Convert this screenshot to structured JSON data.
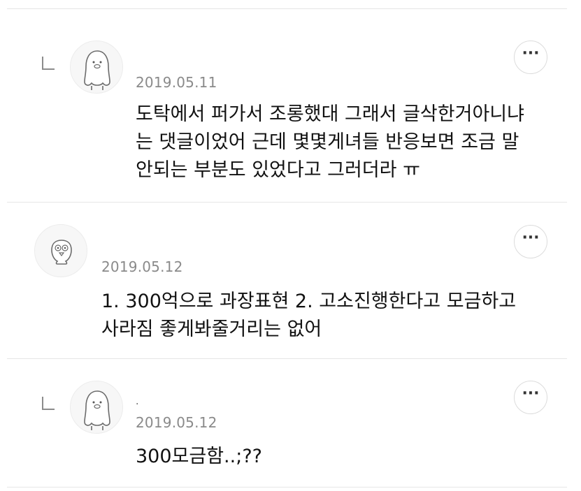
{
  "comments": [
    {
      "is_reply": true,
      "avatar": "penguin-avatar-icon",
      "nickname": "",
      "date": "2019.05.11",
      "text": "도탁에서 퍼가서 조롱했대 그래서 글삭한거아니냐\n는 댓글이었어 근데 몇몇게녀들 반응보면 조금 말\n안되는 부분도 있었다고 그러더라 ㅠ",
      "more_label": "···"
    },
    {
      "is_reply": false,
      "avatar": "chick-avatar-icon",
      "nickname": "",
      "date": "2019.05.12",
      "text": "1. 300억으로 과장표현 2. 고소진행한다고 모금하고\n사라짐 좋게봐줄거리는 없어",
      "more_label": "···"
    },
    {
      "is_reply": true,
      "avatar": "penguin-avatar-icon",
      "nickname": ".",
      "date": "2019.05.12",
      "text": "300모금함..;??",
      "more_label": "···"
    }
  ]
}
